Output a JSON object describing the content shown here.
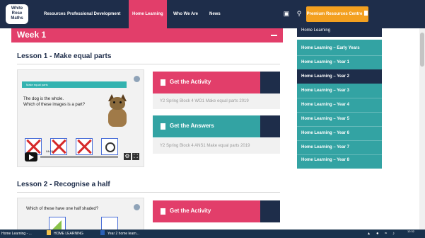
{
  "brand": {
    "logo_text": [
      "White",
      "Rose",
      "Maths"
    ]
  },
  "nav": {
    "items": [
      "Resources",
      "Professional Development",
      "Home Learning",
      "Who We Are",
      "News"
    ],
    "active": "Home Learning",
    "icons": [
      "shop-icon",
      "search-icon"
    ],
    "premium_label": "Premium Resources Centre"
  },
  "main": {
    "week_title": "Week 1",
    "lesson1": {
      "title": "Lesson 1 - Make equal parts",
      "video": {
        "strip_label": "Make equal parts",
        "question_line1": "The dog is the whole.",
        "question_line2": "Which of these images is a part?",
        "time": "04:03"
      },
      "activity": {
        "label": "Get the Activity",
        "file": "Y2 Spring Block 4 WO1 Make equal parts 2019"
      },
      "answers": {
        "label": "Get the Answers",
        "file": "Y2 Spring Block 4 ANS1 Make equal parts 2019"
      }
    },
    "lesson2": {
      "title": "Lesson 2 - Recognise a half",
      "video": {
        "question": "Which of these have one half shaded?"
      },
      "activity": {
        "label": "Get the Activity"
      }
    }
  },
  "sidebar": {
    "heading": "Home Learning",
    "items": [
      "Home Learning – Early Years",
      "Home Learning – Year 1",
      "Home Learning – Year 2",
      "Home Learning – Year 3",
      "Home Learning – Year 4",
      "Home Learning – Year 5",
      "Home Learning – Year 6",
      "Home Learning – Year 7",
      "Home Learning – Year 8"
    ],
    "active_item": "Home Learning – Year 2"
  },
  "taskbar": {
    "items": [
      "Home Learning - ...",
      "HOME LEARNING",
      "Year 2 home learn..."
    ],
    "clock_time": "12:32"
  },
  "colors": {
    "navy": "#1e2d4a",
    "pink": "#e23e6a",
    "teal": "#33a3a3",
    "orange": "#f3a020"
  }
}
